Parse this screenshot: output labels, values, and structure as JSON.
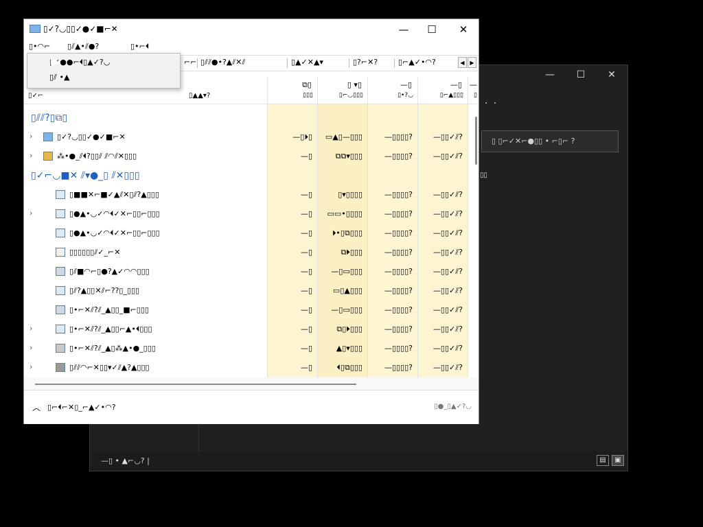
{
  "bg_window": {
    "min": "—",
    "max": "☐",
    "close": "✕",
    "subtitle": "· ·",
    "search": "▯ ▯⌐✓✕⌐●▯▯ • ⌐▯⌐ ?",
    "fragment": "▯▯",
    "status": "—▯ • ▲⌐◡? |",
    "view_details": "▤",
    "view_tiles": "▣"
  },
  "main_window": {
    "title": "▯✓?◡▯▯✓●✓■⌐✕",
    "controls": {
      "min": "—",
      "max": "☐",
      "close": "✕"
    },
    "menu": [
      "▯•◠⌐",
      "▯⫽▲•⫽●?",
      "▯•⌐⏴"
    ],
    "tabs": [
      "⌐⌐",
      "▯⫽⫽●•?▲⫽✕⫽",
      "▯▲✓✕▲▾",
      "▯?⌐✕?",
      "▯⌐▲✓•◠?"
    ],
    "dropdown": [
      "▯✓●●⌐⏴▯▲✓?◡",
      "▯⫽ •▲"
    ],
    "columns": {
      "name": "▯✓⌐",
      "status": "▯▲▲▾?",
      "cpu": {
        "top": "⧉▯",
        "sub": "▯▯▯"
      },
      "memory": {
        "top": "▯ ▾▯",
        "sub": "▯⌐◡▯▯▯"
      },
      "disk": {
        "top": "—▯",
        "sub": "▯•?◡"
      },
      "network": {
        "top": "—▯",
        "sub": "▯⌐▲▯▯▯"
      },
      "gpu": {
        "top": "—",
        "sub": "▯"
      }
    },
    "groups": [
      {
        "title": "▯⫽⫽?▯⧉▯",
        "rows": [
          {
            "name": "▯✓?◡▯▯✓●✓■⌐✕",
            "cpu": "—▯⏵▯",
            "mem": "▭▲▯—▯▯▯",
            "disk": "—▯▯▯▯?",
            "net": "—▯▯✓⫽?",
            "chev": "›"
          },
          {
            "name": "⁂•●_⫽⏴?▯▯⫽ ⫽◠⫽✕▯▯▯",
            "cpu": "—▯",
            "mem": "⧉⧉▾▯▯▯",
            "disk": "—▯▯▯▯?",
            "net": "—▯▯✓⫽?",
            "chev": "›"
          }
        ]
      },
      {
        "title": "▯✓⌐◡■✕ ⫽▾●_▯ ⫽✕▯▯▯",
        "rows": [
          {
            "name": "▯■■✕⌐■✓▲⫽✕▯⫽?▲▯▯▯",
            "cpu": "—▯",
            "mem": "▯▾▯▯▯▯",
            "disk": "—▯▯▯▯?",
            "net": "—▯▯✓⫽?",
            "chev": ""
          },
          {
            "name": "▯●▲•◡✓◠⏴✓✕⌐▯▯⌐▯▯▯",
            "cpu": "—▯",
            "mem": "▭▭•▯▯▯▯",
            "disk": "—▯▯▯▯?",
            "net": "—▯▯✓⫽?",
            "chev": "›"
          },
          {
            "name": "▯●▲•◡✓◠⏴✓✕⌐▯▯⌐▯▯▯",
            "cpu": "—▯",
            "mem": "⏵•▯⧉▯▯▯",
            "disk": "—▯▯▯▯?",
            "net": "—▯▯✓⫽?",
            "chev": ""
          },
          {
            "name": "▯▯▯▯▯▯⫽✓_⌐✕",
            "cpu": "—▯",
            "mem": "⧉⏵▯▯▯",
            "disk": "—▯▯▯▯?",
            "net": "—▯▯✓⫽?",
            "chev": ""
          },
          {
            "name": "▯⫽■◠⌐▯●?▲✓◠◠▯▯▯",
            "cpu": "—▯",
            "mem": "—▯▭▯▯▯",
            "disk": "—▯▯▯▯?",
            "net": "—▯▯✓⫽?",
            "chev": ""
          },
          {
            "name": "▯⫽?▲▯▯✕⫽⌐??▯_▯▯▯",
            "cpu": "—▯",
            "mem": "▭▯▲▯▯▯",
            "disk": "—▯▯▯▯?",
            "net": "—▯▯✓⫽?",
            "chev": ""
          },
          {
            "name": "▯•⌐✕⫽?⫽_▲▯▯_■⌐▯▯▯",
            "cpu": "—▯",
            "mem": "—▯▭▯▯▯",
            "disk": "—▯▯▯▯?",
            "net": "—▯▯✓⫽?",
            "chev": ""
          },
          {
            "name": "▯•⌐✕⫽?⫽_▲▯▯⌐▲•⏴▯▯▯",
            "cpu": "—▯",
            "mem": "⧉▯⏵▯▯▯",
            "disk": "—▯▯▯▯?",
            "net": "—▯▯✓⫽?",
            "chev": "›"
          },
          {
            "name": "▯•⌐✕⫽?⫽_▲▯⁂▲•●_▯▯▯",
            "cpu": "—▯",
            "mem": "▲▯▾▯▯▯",
            "disk": "—▯▯▯▯?",
            "net": "—▯▯✓⫽?",
            "chev": "›"
          },
          {
            "name": "▯⫽⫽◠⌐✕▯▯▾✓⫽▲?▲▯▯▯",
            "cpu": "—▯",
            "mem": "⏴▯⧉▯▯▯",
            "disk": "—▯▯▯▯?",
            "net": "—▯▯✓⫽?",
            "chev": "›"
          }
        ]
      }
    ],
    "footer": {
      "fewer_details": "▯⌐⏴⌐✕▯_⌐▲✓•◠?",
      "end_task": "▯●_▯▲✓?◡"
    }
  },
  "colors": {
    "heat_light": "#fdf6dc",
    "heat_mid": "#fbefbf",
    "heat_strong": "#f7e49b",
    "group_blue": "#1f5fbf"
  }
}
